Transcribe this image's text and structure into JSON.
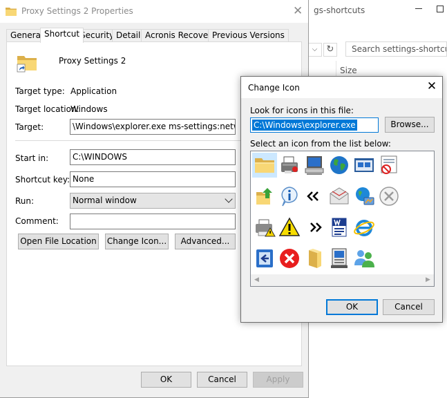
{
  "background_explorer": {
    "title": "gs-shortcuts",
    "search_placeholder": "Search settings-shortcuts",
    "column_header": "Size"
  },
  "properties_dialog": {
    "title": "Proxy Settings 2 Properties",
    "tabs": [
      {
        "label": "General",
        "active": false
      },
      {
        "label": "Shortcut",
        "active": true
      },
      {
        "label": "Security",
        "active": false
      },
      {
        "label": "Details",
        "active": false
      },
      {
        "label": "Acronis Recovery",
        "active": false
      },
      {
        "label": "Previous Versions",
        "active": false
      }
    ],
    "shortcut_name": "Proxy Settings 2",
    "target_type_label": "Target type:",
    "target_type_value": "Application",
    "target_location_label": "Target location:",
    "target_location_value": "Windows",
    "target_label": "Target:",
    "target_value": "\\Windows\\explorer.exe ms-settings:network-proxy",
    "start_in_label": "Start in:",
    "start_in_value": "C:\\WINDOWS",
    "shortcut_key_label": "Shortcut key:",
    "shortcut_key_value": "None",
    "run_label": "Run:",
    "run_value": "Normal window",
    "comment_label": "Comment:",
    "comment_value": "",
    "buttons": {
      "open_file_location": "Open File Location",
      "change_icon": "Change Icon...",
      "advanced": "Advanced..."
    },
    "footer": {
      "ok": "OK",
      "cancel": "Cancel",
      "apply": "Apply"
    }
  },
  "change_icon_dialog": {
    "title": "Change Icon",
    "look_for_label": "Look for icons in this file:",
    "path_value": "C:\\Windows\\explorer.exe",
    "browse_label": "Browse...",
    "select_label": "Select an icon from the list below:",
    "icons": [
      [
        "folder-icon",
        "fax-printer-icon",
        "computer-icon",
        "globe-icon",
        "network-window-icon",
        "blocked-document-icon"
      ],
      [
        "folder-up-icon",
        "info-icon",
        "back-chevrons-icon",
        "mail-icon",
        "network-globe-icon",
        "cancel-circle-icon"
      ],
      [
        "printer-warning-icon",
        "warning-icon",
        "forward-chevrons-icon",
        "word-document-icon",
        "internet-explorer-icon"
      ],
      [
        "exit-door-icon",
        "error-icon",
        "folder-open-icon",
        "server-icon",
        "users-icon"
      ]
    ],
    "selected_icon": "folder-icon",
    "ok_label": "OK",
    "cancel_label": "Cancel"
  }
}
